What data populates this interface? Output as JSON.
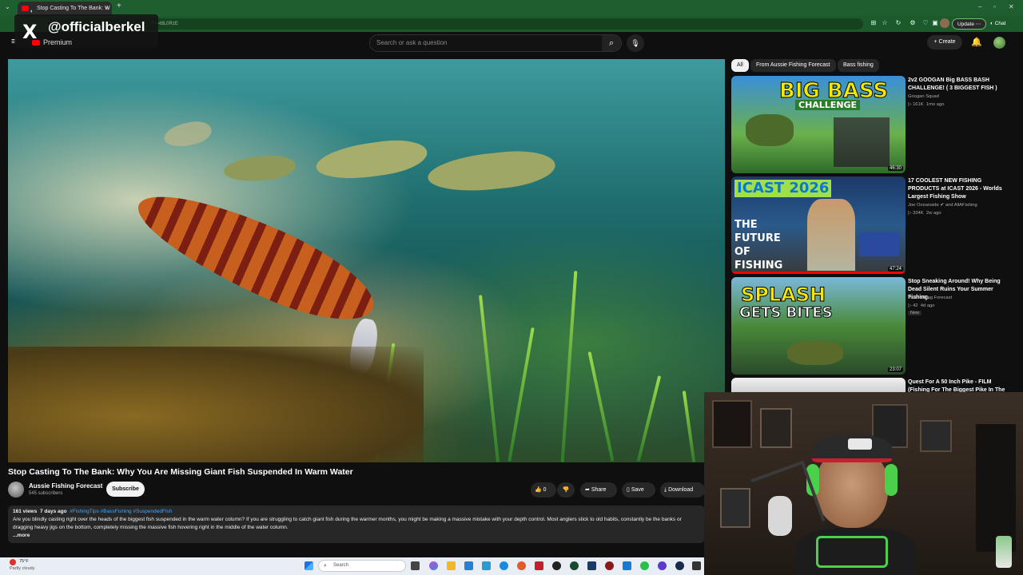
{
  "browser": {
    "tab_title": "Stop Casting To The Bank: W",
    "url": "?v=t8L0RzE",
    "update_label": "Update",
    "chat_label": "Chat"
  },
  "overlay": {
    "x_logo": "X",
    "handle": "@officialberkel",
    "premium_label": "Premium"
  },
  "header": {
    "search_placeholder": "Search or ask a question",
    "create_label": "Create"
  },
  "video": {
    "title": "Stop Casting To The Bank: Why You Are Missing Giant Fish Suspended In Warm Water",
    "channel": "Aussie Fishing Forecast",
    "subscribers": "545 subscribers",
    "subscribe_label": "Subscribe",
    "likes": "0",
    "share_label": "Share",
    "save_label": "Save",
    "download_label": "Download",
    "views": "161 views",
    "date": "7 days ago",
    "hashtags": "#FishingTips #BassFishing #SuspendedFish",
    "description": "Are you blindly casting right over the heads of the biggest fish suspended in the warm water column? If you are struggling to catch giant fish during the warmer months, you might be making a massive mistake with your depth control. Most anglers stick to old habits, constantly be the banks or dragging heavy jigs on the bottom, completely missing the massive fish hovering right in the middle of the water column.",
    "more_label": "...more"
  },
  "chips": [
    "All",
    "From Aussie Fishing Forecast",
    "Bass fishing"
  ],
  "recommendations": [
    {
      "title": "2v2 GOOGAN Big BASS BASH CHALLENGE! ( 3 BIGGEST FISH )",
      "channel": "Googan Squad",
      "views": "161K",
      "age": "1mo ago",
      "duration": "46:30",
      "thumb_text_1": "BIG BASS",
      "thumb_text_2": "CHALLENGE"
    },
    {
      "title": "17 COOLEST NEW FISHING PRODUCTS at ICAST 2026 - Worlds Largest Fishing Show",
      "channel": "Joe Oceanside",
      "channel_extra": "and AllAFishing",
      "views": "334K",
      "age": "2w ago",
      "duration": "47:24",
      "thumb_text_1": "ICAST 2026",
      "thumb_text_2": "THE FUTURE OF FISHING"
    },
    {
      "title": "Stop Sneaking Around! Why Being Dead Silent Ruins Your Summer Fishing.",
      "channel": "Kiwi Fishing Forecast",
      "views": "42",
      "age": "4d ago",
      "badge": "New",
      "duration": "23:07",
      "thumb_text_1": "SPLASH",
      "thumb_text_2": "GETS BITES"
    },
    {
      "title": "Quest For A 50 Inch Pike - FILM (Fishing For The Biggest Pike In The World)"
    }
  ],
  "taskbar": {
    "temperature": "75°F",
    "weather": "Partly cloudy",
    "search_label": "Search"
  },
  "colors": {
    "chrome_green": "#1f5e2e",
    "yt_background": "#0f0f0f",
    "link_blue": "#3ea6ff"
  }
}
